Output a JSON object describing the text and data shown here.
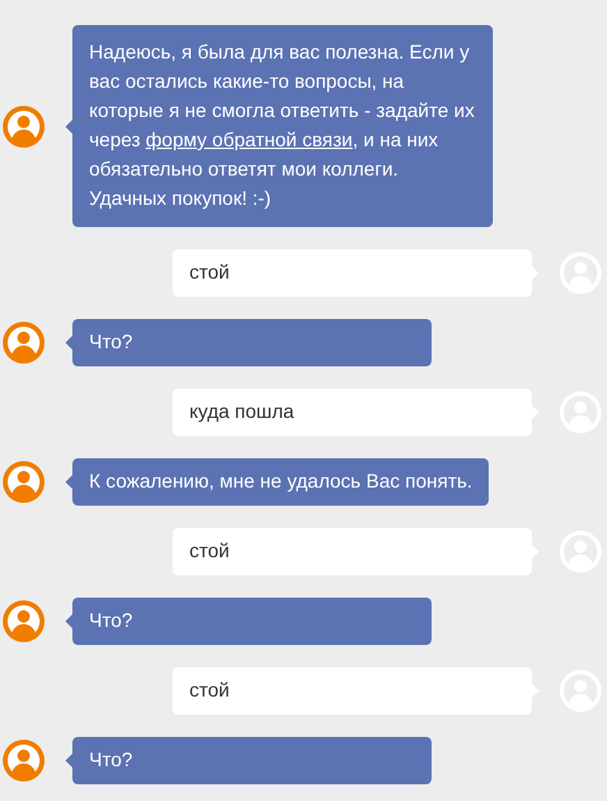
{
  "messages": [
    {
      "kind": "bot",
      "text": "Надеюсь, я была для вас полезна. Если у вас остались какие-то вопросы, на которые я не смогла ответить - задайте их через ",
      "link": "форму обратной связи",
      "text_after": ", и на них обязательно ответят мои коллеги. Удачных покупок! :-)"
    },
    {
      "kind": "user",
      "text": "стой"
    },
    {
      "kind": "bot",
      "text": "Что?"
    },
    {
      "kind": "user",
      "text": "куда пошла"
    },
    {
      "kind": "bot",
      "text": "К сожалению, мне не удалось Вас понять."
    },
    {
      "kind": "user",
      "text": "стой"
    },
    {
      "kind": "bot",
      "text": "Что?"
    },
    {
      "kind": "user",
      "text": "стой"
    },
    {
      "kind": "bot",
      "text": "Что?"
    }
  ]
}
